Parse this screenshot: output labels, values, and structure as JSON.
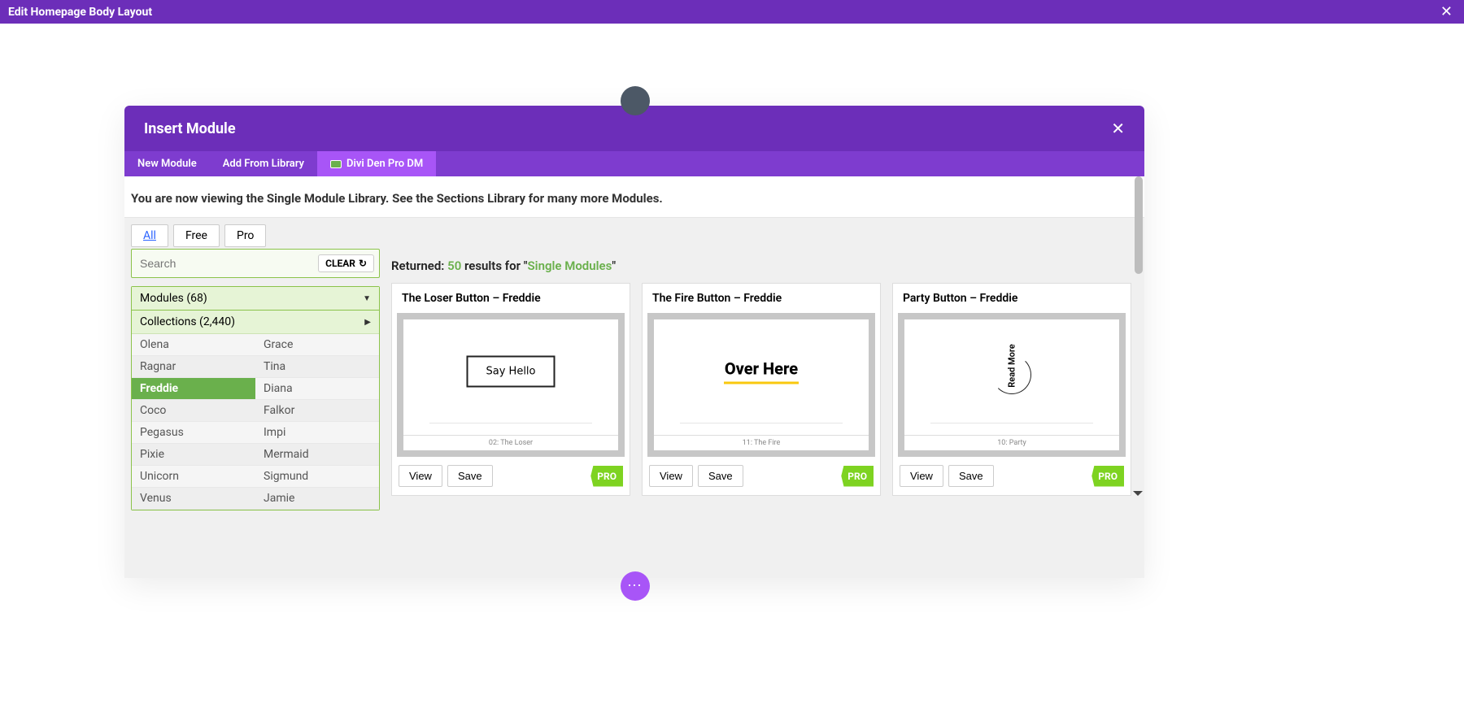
{
  "top_bar": {
    "title": "Edit Homepage Body Layout"
  },
  "modal": {
    "title": "Insert Module",
    "tabs": [
      "New Module",
      "Add From Library",
      "Divi Den Pro DM"
    ],
    "active_tab": 2,
    "notice": "You are now viewing the Single Module Library. See the Sections Library for many more Modules."
  },
  "filter_tabs": {
    "items": [
      "All",
      "Free",
      "Pro"
    ],
    "active": 0
  },
  "search": {
    "placeholder": "Search",
    "clear": "CLEAR"
  },
  "accordion": {
    "modules": {
      "label": "Modules (68)"
    },
    "collections": {
      "label": "Collections (2,440)"
    }
  },
  "collections_grid": {
    "rows": [
      [
        "Olena",
        "Grace"
      ],
      [
        "Ragnar",
        "Tina"
      ],
      [
        "Freddie",
        "Diana"
      ],
      [
        "Coco",
        "Falkor"
      ],
      [
        "Pegasus",
        "Impi"
      ],
      [
        "Pixie",
        "Mermaid"
      ],
      [
        "Unicorn",
        "Sigmund"
      ],
      [
        "Venus",
        "Jamie"
      ]
    ],
    "selected": "Freddie"
  },
  "results": {
    "returned_label": "Returned:",
    "count": "50",
    "mid": "results for \"",
    "query": "Single Modules",
    "end": "\""
  },
  "cards": [
    {
      "title": "The Loser Button – Freddie",
      "thumb_text": "Say Hello",
      "caption": "02: The Loser",
      "view": "View",
      "save": "Save",
      "badge": "PRO",
      "type": "loser"
    },
    {
      "title": "The Fire Button – Freddie",
      "thumb_text": "Over Here",
      "caption": "11: The Fire",
      "view": "View",
      "save": "Save",
      "badge": "PRO",
      "type": "fire"
    },
    {
      "title": "Party Button – Freddie",
      "thumb_text": "Read More",
      "caption": "10: Party",
      "view": "View",
      "save": "Save",
      "badge": "PRO",
      "type": "party"
    }
  ]
}
